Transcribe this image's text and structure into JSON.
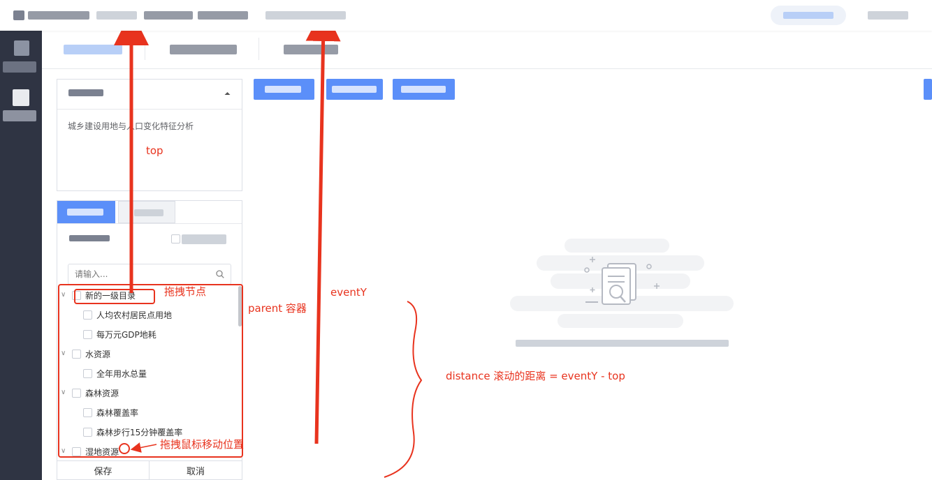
{
  "info_card": {
    "description": "城乡建设用地与人口变化特征分析"
  },
  "search": {
    "placeholder": "请输入..."
  },
  "tree": [
    {
      "label": "新的一级目录",
      "level": 0,
      "expanded": true
    },
    {
      "label": "人均农村居民点用地",
      "level": 1
    },
    {
      "label": "每万元GDP地耗",
      "level": 1
    },
    {
      "label": "水资源",
      "level": 0,
      "expanded": true
    },
    {
      "label": "全年用水总量",
      "level": 1
    },
    {
      "label": "森林资源",
      "level": 0,
      "expanded": true
    },
    {
      "label": "森林覆盖率",
      "level": 1
    },
    {
      "label": "森林步行15分钟覆盖率",
      "level": 1
    },
    {
      "label": "湿地资源",
      "level": 0,
      "expanded": true
    }
  ],
  "footer": {
    "save": "保存",
    "cancel": "取消"
  },
  "annotations": {
    "top": "top",
    "drag_node": "拖拽节点",
    "parent": "parent 容器",
    "event_y": "eventY",
    "distance": "distance 滚动的距离 = eventY - top",
    "mouse_pos": "拖拽鼠标移动位置"
  },
  "colors": {
    "accent": "#5b8ff9",
    "sidebar": "#2f3443",
    "annotation": "#e8331e"
  },
  "icons": {
    "search": "search-icon",
    "chevron_up": "chevron-up-icon",
    "chevron_down": "chevron-down-icon",
    "empty": "empty-document-search-icon"
  }
}
